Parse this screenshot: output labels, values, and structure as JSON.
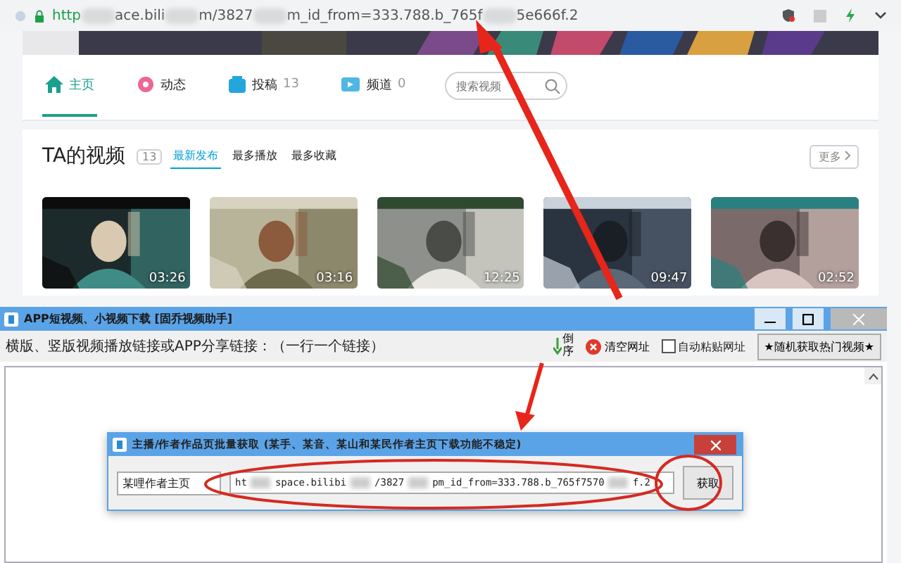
{
  "browser": {
    "url_parts": [
      "http",
      "ace.bili",
      "m/3827",
      "m_id_from=333.788.b_765f",
      "5e666f.2"
    ]
  },
  "nav": {
    "tabs": [
      {
        "label": "主页",
        "selected": true
      },
      {
        "label": "动态",
        "selected": false
      },
      {
        "label": "投稿",
        "count": "13",
        "selected": false
      },
      {
        "label": "频道",
        "count": "0",
        "selected": false
      }
    ],
    "search": {
      "placeholder": "搜索视频"
    }
  },
  "videos": {
    "title": "TA的视频",
    "count": "13",
    "sort_tabs": [
      {
        "label": "最新发布",
        "selected": true
      },
      {
        "label": "最多播放",
        "selected": false
      },
      {
        "label": "最多收藏",
        "selected": false
      }
    ],
    "more": "更多",
    "items": [
      {
        "duration": "03:26"
      },
      {
        "duration": "03:16"
      },
      {
        "duration": "12:25"
      },
      {
        "duration": "09:47"
      },
      {
        "duration": "02:52"
      }
    ]
  },
  "app_window": {
    "title": "APP短视频、小视频下载 [固乔视频助手]",
    "prompt": "横版、竖版视频播放链接或APP分享链接：（一行一个链接）",
    "reverse": "倒序",
    "clear": "清空网址",
    "auto_paste": {
      "label": "自动粘贴网址",
      "checked": false
    },
    "random_button": "★随机获取热门视频★"
  },
  "dialog": {
    "title": "主播/作者作品页批量获取 (某手、某音、某山和某民作者主页下载功能不稳定)",
    "source": "某哩作者主页",
    "url_parts": [
      "ht",
      "space.bilibi",
      "/3827",
      "pm_id_from=333.788.b_765f7570",
      "f.2"
    ],
    "fetch": "获取"
  }
}
